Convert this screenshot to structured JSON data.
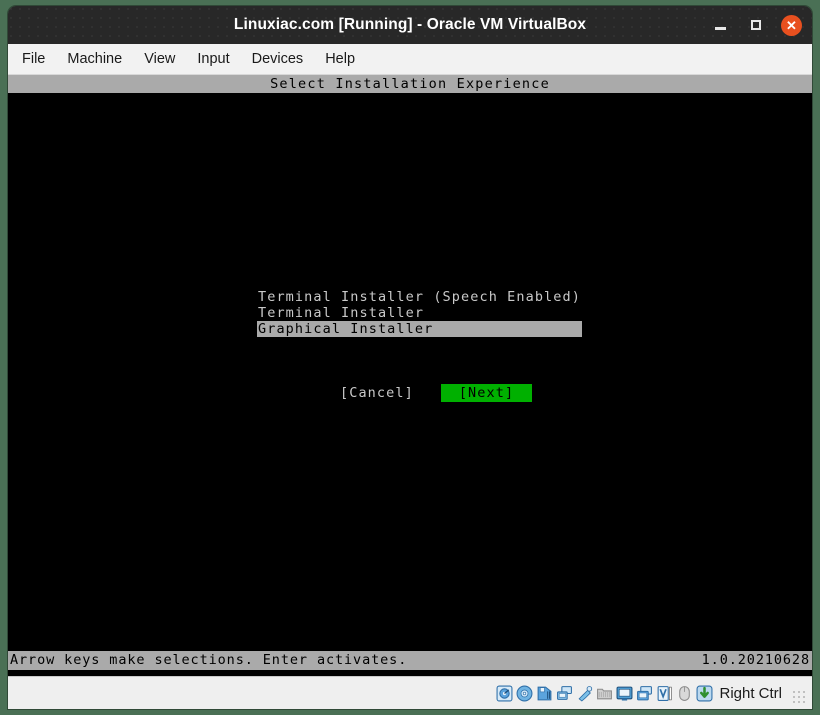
{
  "window": {
    "title": "Linuxiac.com [Running] - Oracle VM VirtualBox",
    "controls": {
      "minimize_label": "Minimize",
      "maximize_label": "Maximize",
      "close_label": "✕"
    },
    "accent_close_color": "#e8501f",
    "desktop_background_color": "#4a7055"
  },
  "menubar": {
    "items": [
      {
        "label": "File"
      },
      {
        "label": "Machine"
      },
      {
        "label": "View"
      },
      {
        "label": "Input"
      },
      {
        "label": "Devices"
      },
      {
        "label": "Help"
      }
    ]
  },
  "installer": {
    "header_title": "Select Installation Experience",
    "options": [
      {
        "label": "Terminal Installer (Speech Enabled)",
        "selected": false
      },
      {
        "label": "Terminal Installer",
        "selected": false
      },
      {
        "label": "Graphical Installer",
        "selected": true
      }
    ],
    "buttons": {
      "cancel_label": "[Cancel]",
      "next_label": "[Next]",
      "next_background_color": "#00b000"
    },
    "status": {
      "hint": "Arrow keys make selections. Enter activates.",
      "version": "1.0.20210628"
    },
    "colors": {
      "screen_background": "#000000",
      "bar_background": "#aaaaaa",
      "text": "#c9c9c9"
    }
  },
  "vb_statusbar": {
    "icons": [
      {
        "name": "hard-disk-icon"
      },
      {
        "name": "optical-disk-icon"
      },
      {
        "name": "floppy-disk-icon"
      },
      {
        "name": "network-icon"
      },
      {
        "name": "usb-icon"
      },
      {
        "name": "shared-folders-icon"
      },
      {
        "name": "display-icon"
      },
      {
        "name": "recording-icon"
      },
      {
        "name": "virtualization-icon"
      },
      {
        "name": "mouse-icon"
      },
      {
        "name": "host-key-icon"
      }
    ],
    "host_key_label": "Right Ctrl"
  }
}
